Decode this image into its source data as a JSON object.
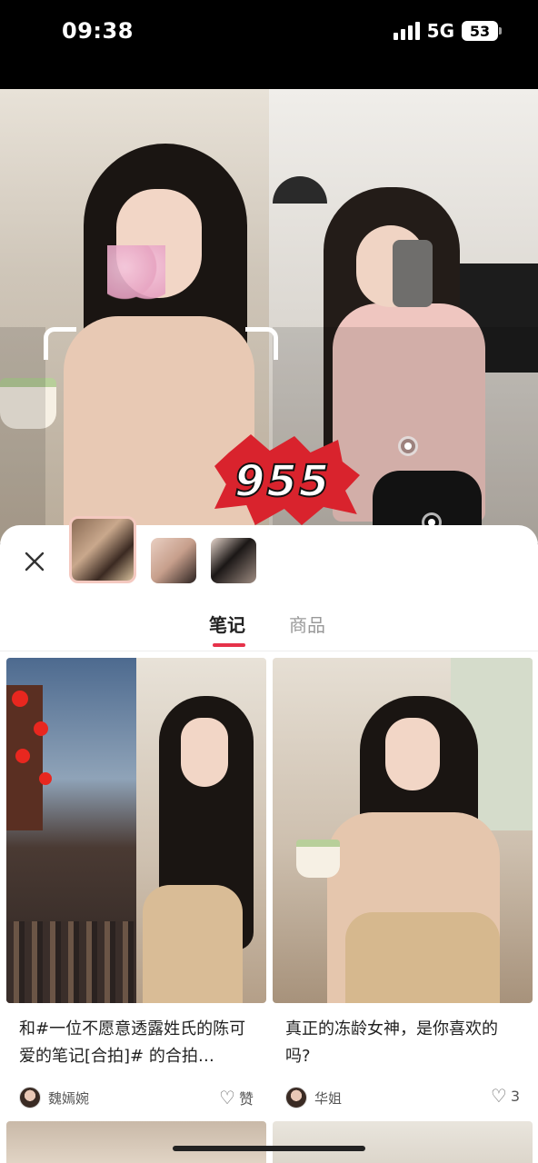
{
  "status_bar": {
    "time": "09:38",
    "network": "5G",
    "battery": "53"
  },
  "hero": {
    "badge_text": "955"
  },
  "sheet": {
    "close_icon": "close-icon",
    "tabs": [
      {
        "label": "笔记",
        "active": true
      },
      {
        "label": "商品",
        "active": false
      }
    ],
    "cards": [
      {
        "title": "和#一位不愿意透露姓氏的陈可爱的笔记[合拍]# 的合拍…",
        "author": "魏嫣婉",
        "likes": "赞"
      },
      {
        "title": "真正的冻龄女神，是你喜欢的吗?",
        "author": "华姐",
        "likes": "3"
      }
    ]
  },
  "colors": {
    "accent": "#e6324a",
    "badge": "#d9232d"
  }
}
